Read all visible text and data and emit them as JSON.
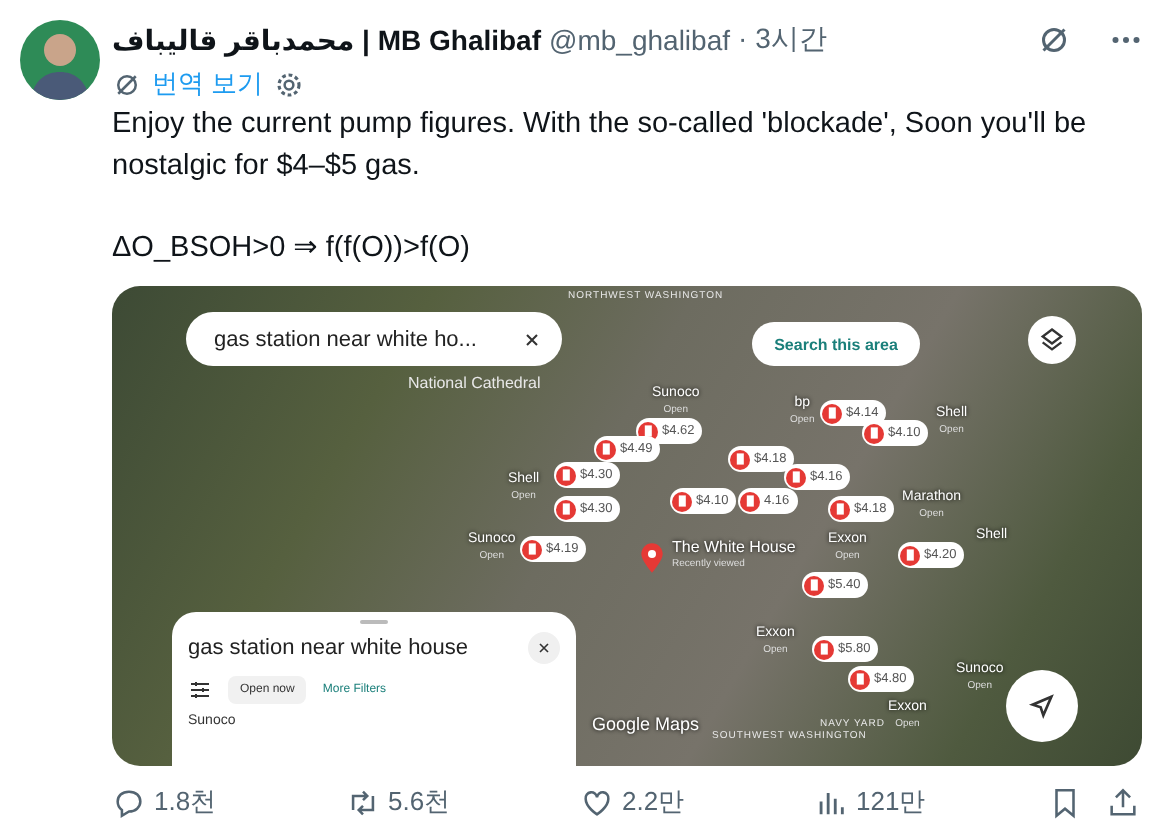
{
  "author": {
    "name": "محمدباقر قالیباف | MB Ghalibaf",
    "handle": "@mb_ghalibaf",
    "time": "· 3시간"
  },
  "translate": "번역 보기",
  "paragraphs": [
    "Enjoy the current pump figures. With the so-called 'blockade', Soon you'll be nostalgic for $4–$5 gas.",
    "ΔO_BSOH>0 ⇒ f(f(O))>f(O)"
  ],
  "map": {
    "search_field": "gas station near white ho...",
    "search_area_button": "Search this area",
    "area_labels": [
      "NORTHWEST WASHINGTON",
      "National Cathedral",
      "NAVY YARD",
      "SOUTHWEST WASHINGTON"
    ],
    "places": [
      {
        "name": "Sunoco",
        "status": "Open"
      },
      {
        "name": "bp",
        "status": "Open"
      },
      {
        "name": "Shell",
        "status": "Open"
      },
      {
        "name": "Shell",
        "status": "Open"
      },
      {
        "name": "Sunoco",
        "status": "Open"
      },
      {
        "name": "Marathon",
        "status": "Open"
      },
      {
        "name": "Exxon",
        "status": "Open"
      },
      {
        "name": "Shell"
      },
      {
        "name": "Exxon",
        "status": "Open"
      },
      {
        "name": "Sunoco",
        "status": "Open"
      },
      {
        "name": "Exxon",
        "status": "Open"
      }
    ],
    "pins": [
      {
        "price": "$4.62"
      },
      {
        "price": "$4.49"
      },
      {
        "price": "$4.30"
      },
      {
        "price": "$4.30"
      },
      {
        "price": "$4.19"
      },
      {
        "price": "$4.18"
      },
      {
        "price": "$4.14"
      },
      {
        "price": "$4.10"
      },
      {
        "price": "$4.10"
      },
      {
        "price": "4.16"
      },
      {
        "price": "$4.16"
      },
      {
        "price": "$4.18"
      },
      {
        "price": "$4.20"
      },
      {
        "price": "$5.40"
      },
      {
        "price": "$5.80"
      },
      {
        "price": "$4.80"
      }
    ],
    "landmark": {
      "name": "The White House",
      "note": "Recently viewed"
    },
    "logo": "Google Maps",
    "sheet": {
      "title": "gas station near white house",
      "filters": [
        {
          "label": "Open now",
          "kind": "chip"
        },
        {
          "label": "More Filters",
          "kind": "link"
        }
      ],
      "first_result": "Sunoco"
    }
  },
  "stats": {
    "replies": "1.8천",
    "reposts": "5.6천",
    "likes": "2.2만",
    "views": "121만"
  }
}
